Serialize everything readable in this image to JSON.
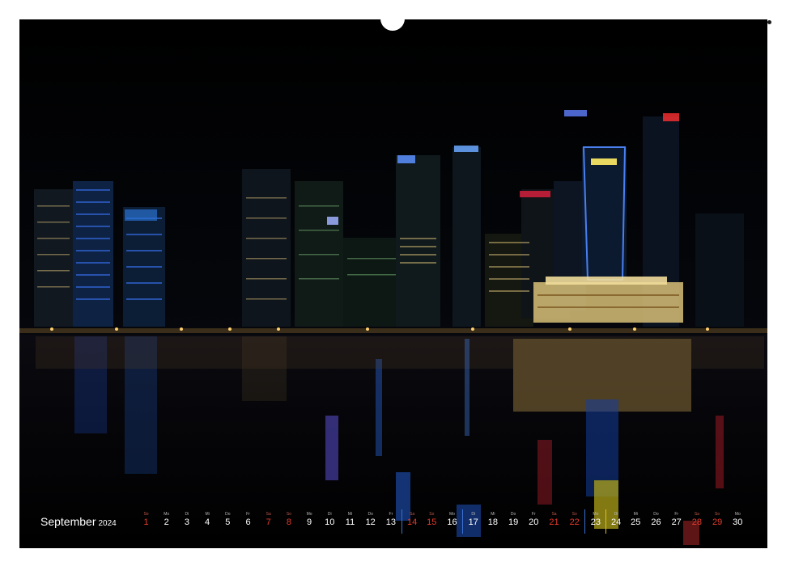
{
  "calendar": {
    "month": "September",
    "year": "2024",
    "days": [
      {
        "wd": "So",
        "n": "1",
        "we": true
      },
      {
        "wd": "Mo",
        "n": "2",
        "we": false
      },
      {
        "wd": "Di",
        "n": "3",
        "we": false
      },
      {
        "wd": "Mi",
        "n": "4",
        "we": false
      },
      {
        "wd": "Do",
        "n": "5",
        "we": false
      },
      {
        "wd": "Fr",
        "n": "6",
        "we": false
      },
      {
        "wd": "Sa",
        "n": "7",
        "we": true
      },
      {
        "wd": "So",
        "n": "8",
        "we": true
      },
      {
        "wd": "Mo",
        "n": "9",
        "we": false
      },
      {
        "wd": "Di",
        "n": "10",
        "we": false
      },
      {
        "wd": "Mi",
        "n": "11",
        "we": false
      },
      {
        "wd": "Do",
        "n": "12",
        "we": false
      },
      {
        "wd": "Fr",
        "n": "13",
        "we": false
      },
      {
        "wd": "Sa",
        "n": "14",
        "we": true
      },
      {
        "wd": "So",
        "n": "15",
        "we": true
      },
      {
        "wd": "Mo",
        "n": "16",
        "we": false
      },
      {
        "wd": "Di",
        "n": "17",
        "we": false
      },
      {
        "wd": "Mi",
        "n": "18",
        "we": false
      },
      {
        "wd": "Do",
        "n": "19",
        "we": false
      },
      {
        "wd": "Fr",
        "n": "20",
        "we": false
      },
      {
        "wd": "Sa",
        "n": "21",
        "we": true
      },
      {
        "wd": "So",
        "n": "22",
        "we": true
      },
      {
        "wd": "Mo",
        "n": "23",
        "we": false
      },
      {
        "wd": "Di",
        "n": "24",
        "we": false
      },
      {
        "wd": "Mi",
        "n": "25",
        "we": false
      },
      {
        "wd": "Do",
        "n": "26",
        "we": false
      },
      {
        "wd": "Fr",
        "n": "27",
        "we": false
      },
      {
        "wd": "Sa",
        "n": "28",
        "we": true
      },
      {
        "wd": "So",
        "n": "29",
        "we": true
      },
      {
        "wd": "Mo",
        "n": "30",
        "we": false
      }
    ]
  },
  "colors": {
    "weekend": "#e23a2a",
    "background": "#000000",
    "text": "#ffffff"
  }
}
